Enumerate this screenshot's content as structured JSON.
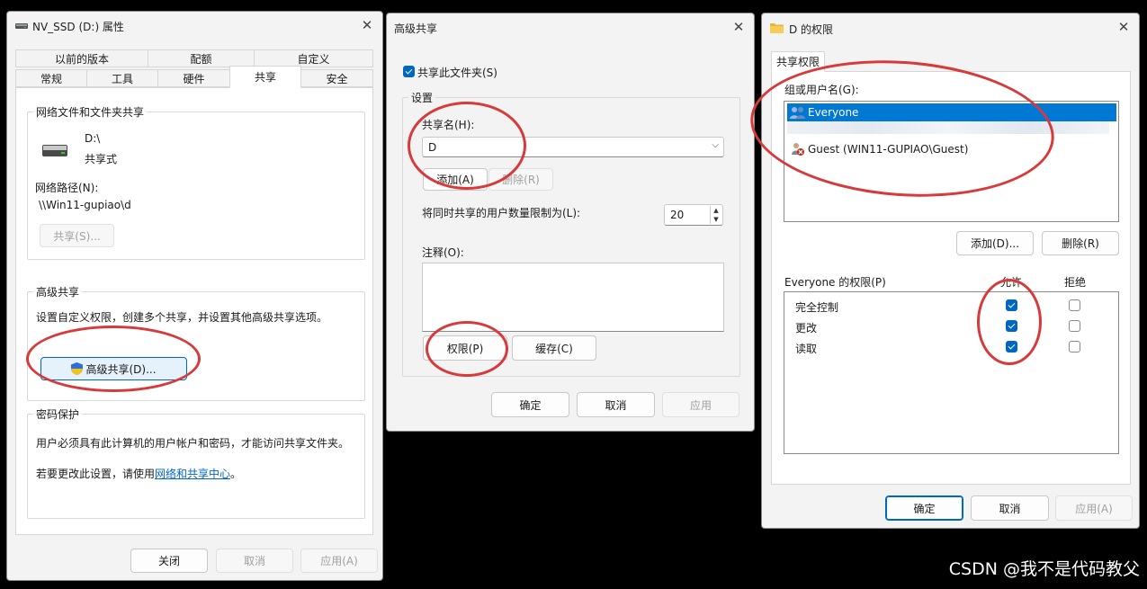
{
  "dlg1": {
    "title": "NV_SSD (D:) 属性",
    "tabs_row1": [
      "以前的版本",
      "配额",
      "自定义"
    ],
    "tabs_row2": [
      "常规",
      "工具",
      "硬件",
      "共享",
      "安全"
    ],
    "network_group": "网络文件和文件夹共享",
    "drive_name": "D:\\",
    "share_state": "共享式",
    "path_label": "网络路径(N):",
    "path_value": "\\\\Win11-gupiao\\d",
    "share_button": "共享(S)...",
    "adv_group": "高级共享",
    "adv_desc": "设置自定义权限，创建多个共享，并设置其他高级共享选项。",
    "adv_button": "高级共享(D)...",
    "pwd_group": "密码保护",
    "pwd_desc": "用户必须具有此计算机的用户帐户和密码，才能访问共享文件夹。",
    "pwd_change_prefix": "若要更改此设置，请使用",
    "pwd_link": "网络和共享中心",
    "pwd_change_suffix": "。",
    "ok": "关闭",
    "cancel": "取消",
    "apply": "应用(A)"
  },
  "dlg2": {
    "title": "高级共享",
    "share_checkbox": "共享此文件夹(S)",
    "settings_group": "设置",
    "share_name_label": "共享名(H):",
    "share_name_value": "D",
    "add_button": "添加(A)",
    "remove_button": "删除(R)",
    "limit_label": "将同时共享的用户数量限制为(L):",
    "limit_value": "20",
    "comment_label": "注释(O):",
    "perm_button": "权限(P)",
    "cache_button": "缓存(C)",
    "ok": "确定",
    "cancel": "取消",
    "apply": "应用"
  },
  "dlg3": {
    "title": "D 的权限",
    "tab": "共享权限",
    "users_label": "组或用户名(G):",
    "users": [
      "Everyone",
      "Guest (WIN11-GUPIAO\\Guest)"
    ],
    "add_button": "添加(D)...",
    "remove_button": "删除(R)",
    "perm_label": "Everyone 的权限(P)",
    "allow_header": "允许",
    "deny_header": "拒绝",
    "permissions": [
      {
        "name": "完全控制",
        "allow": true,
        "deny": false
      },
      {
        "name": "更改",
        "allow": true,
        "deny": false
      },
      {
        "name": "读取",
        "allow": true,
        "deny": false
      }
    ],
    "ok": "确定",
    "cancel": "取消",
    "apply": "应用(A)"
  },
  "watermark": "CSDN @我不是代码教父",
  "colors": {
    "accent": "#0067c0",
    "annotation": "#d63a3a",
    "selection": "#0078d4"
  }
}
